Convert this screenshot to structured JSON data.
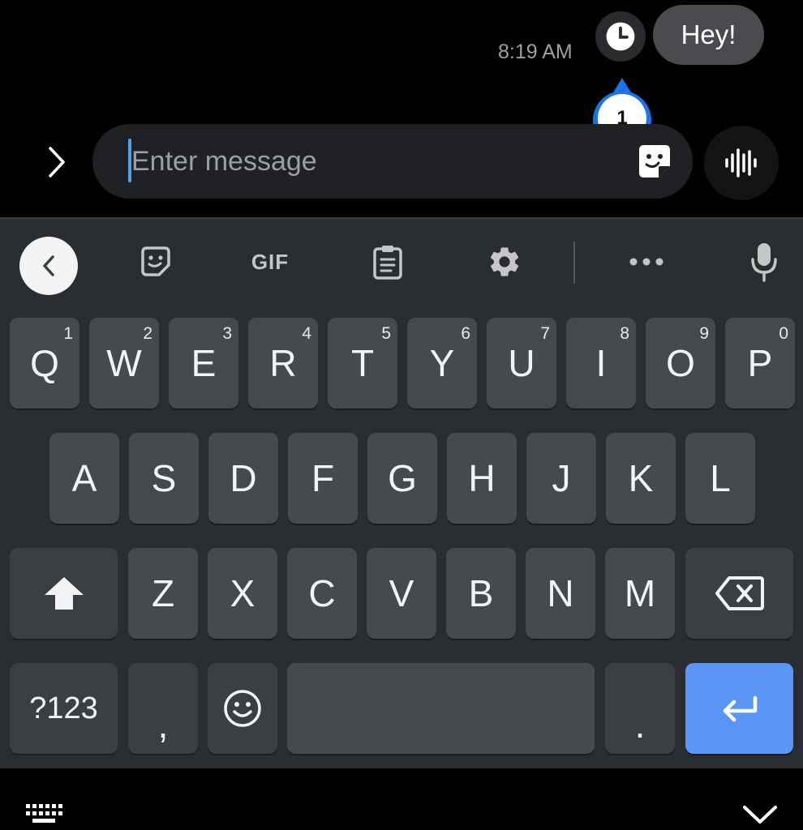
{
  "conversation": {
    "time": "8:19 AM",
    "message": "Hey!",
    "tooltip_number": "1"
  },
  "compose": {
    "placeholder": "Enter message"
  },
  "toolbar": {
    "gif_label": "GIF"
  },
  "keyboard": {
    "row1": [
      {
        "key": "Q",
        "hint": "1"
      },
      {
        "key": "W",
        "hint": "2"
      },
      {
        "key": "E",
        "hint": "3"
      },
      {
        "key": "R",
        "hint": "4"
      },
      {
        "key": "T",
        "hint": "5"
      },
      {
        "key": "Y",
        "hint": "6"
      },
      {
        "key": "U",
        "hint": "7"
      },
      {
        "key": "I",
        "hint": "8"
      },
      {
        "key": "O",
        "hint": "9"
      },
      {
        "key": "P",
        "hint": "0"
      }
    ],
    "row2": [
      "A",
      "S",
      "D",
      "F",
      "G",
      "H",
      "J",
      "K",
      "L"
    ],
    "row3": [
      "Z",
      "X",
      "C",
      "V",
      "B",
      "N",
      "M"
    ],
    "symbols_label": "?123",
    "comma_label": ",",
    "period_label": "."
  },
  "colors": {
    "accent": "#5b95f5",
    "tooltip": "#1a73e8",
    "key": "#464a4f",
    "keyboard_bg": "#2a2d32"
  },
  "icons": [
    "clock-icon",
    "chevron-right-icon",
    "sticker-icon",
    "voice-wave-icon",
    "back-arrow-icon",
    "emoji-sticker-icon",
    "clipboard-icon",
    "gear-icon",
    "more-icon",
    "microphone-icon",
    "shift-icon",
    "backspace-icon",
    "emoji-icon",
    "enter-icon",
    "keyboard-switch-icon",
    "chevron-down-icon"
  ]
}
